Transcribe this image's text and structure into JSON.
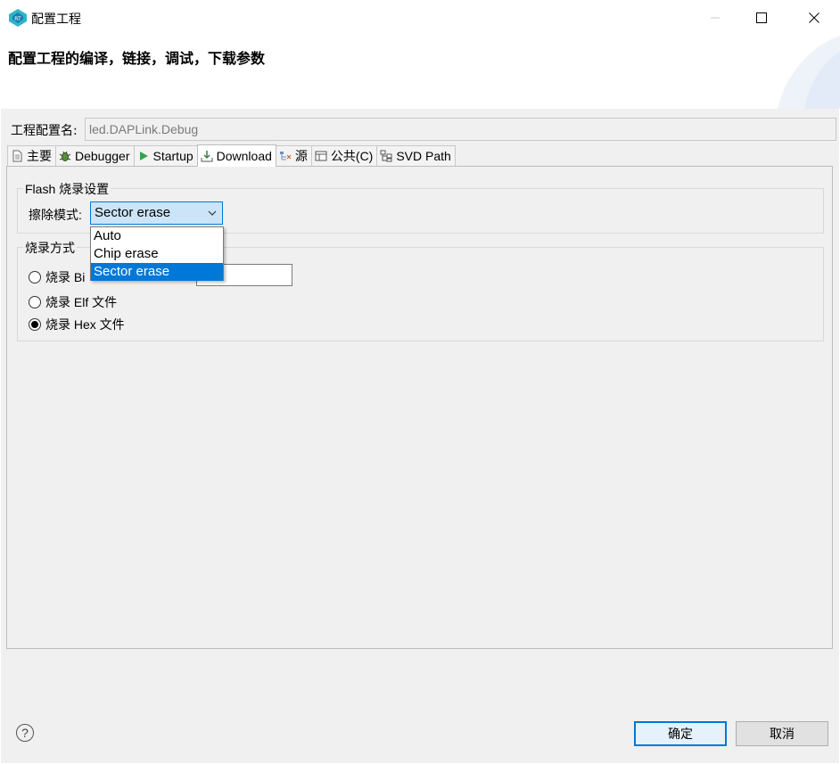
{
  "window": {
    "title": "配置工程",
    "controls": {
      "minimize": "minimize-icon",
      "maximize": "maximize-icon",
      "close": "close-icon"
    }
  },
  "header": {
    "title": "配置工程的编译，链接，调试，下载参数"
  },
  "config_name": {
    "label": "工程配置名:",
    "value": "led.DAPLink.Debug"
  },
  "tabs": [
    {
      "label": "主要",
      "icon": "document-icon"
    },
    {
      "label": "Debugger",
      "icon": "bug-icon"
    },
    {
      "label": "Startup",
      "icon": "play-icon"
    },
    {
      "label": "Download",
      "icon": "download-icon",
      "active": true
    },
    {
      "label": "源",
      "icon": "source-icon"
    },
    {
      "label": "公共(C)",
      "icon": "table-icon"
    },
    {
      "label": "SVD Path",
      "icon": "tree-icon"
    }
  ],
  "flash_group": {
    "title": "Flash 烧录设置",
    "erase_label": "擦除模式:",
    "erase_value": "Sector erase",
    "erase_options": [
      "Auto",
      "Chip erase",
      "Sector erase"
    ]
  },
  "burn_group": {
    "title": "烧录方式",
    "options": [
      {
        "label": "烧录 Bi",
        "checked": false
      },
      {
        "label": "烧录 Elf 文件",
        "checked": false
      },
      {
        "label": "烧录 Hex 文件",
        "checked": true
      }
    ]
  },
  "footer": {
    "help": "?",
    "ok": "确定",
    "cancel": "取消"
  },
  "colors": {
    "accent": "#0078d7",
    "selection_bg": "#cce4f7",
    "panel_bg": "#f0f0f0"
  }
}
